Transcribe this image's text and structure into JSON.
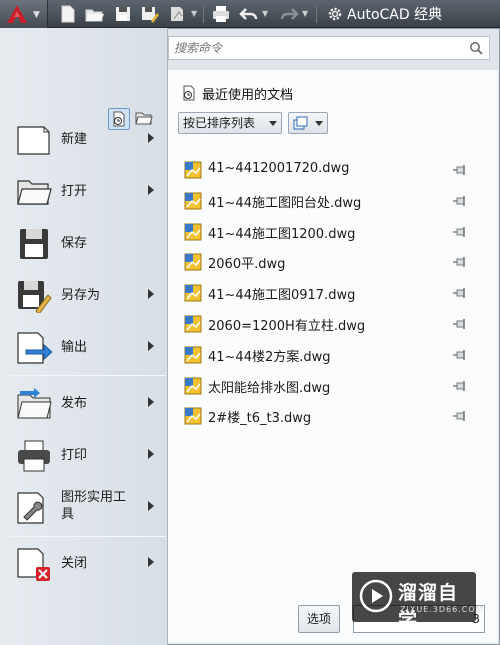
{
  "toolbar": {
    "workspace_label": "AutoCAD 经典"
  },
  "search": {
    "placeholder": "搜索命令"
  },
  "menu": {
    "items": [
      {
        "label": "新建"
      },
      {
        "label": "打开"
      },
      {
        "label": "保存"
      },
      {
        "label": "另存为"
      },
      {
        "label": "输出"
      },
      {
        "label": "发布"
      },
      {
        "label": "打印"
      },
      {
        "label": "图形实用工具"
      },
      {
        "label": "关闭"
      }
    ]
  },
  "recent": {
    "title": "最近使用的文档",
    "sort_label": "按已排序列表",
    "files": [
      "41~4412001720.dwg",
      "41~44施工图阳台处.dwg",
      "41~44施工图1200.dwg",
      "2060平.dwg",
      "41~44施工图0917.dwg",
      "2060=1200H有立柱.dwg",
      "41~44楼2方案.dwg",
      "太阳能给排水图.dwg",
      "2#楼_t6_t3.dwg"
    ]
  },
  "footer": {
    "options_label": "选项",
    "exit_label": "3"
  },
  "watermark": {
    "title": "溜溜自学",
    "url": "ZIXUE.3D66.COM"
  },
  "colors": {
    "accent_red": "#c8202a",
    "selection_blue": "#6f98c4"
  }
}
